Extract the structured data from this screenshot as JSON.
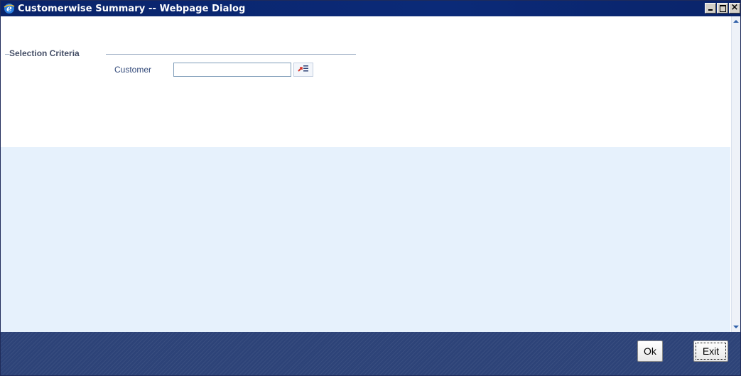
{
  "window": {
    "title": "Customerwise Summary -- Webpage Dialog",
    "icon": "ie-icon",
    "controls": [
      "minimize",
      "maximize",
      "close"
    ]
  },
  "selection_criteria": {
    "legend": "Selection Criteria",
    "customer": {
      "label": "Customer",
      "value": "",
      "lov_icon": "list-of-values-icon"
    }
  },
  "footer": {
    "ok_label": "Ok",
    "exit_label": "Exit"
  },
  "colors": {
    "titlebar": "#0a246a",
    "results_background": "#e6f1fc",
    "footer": "#2d4378",
    "label_text": "#334a7a"
  }
}
